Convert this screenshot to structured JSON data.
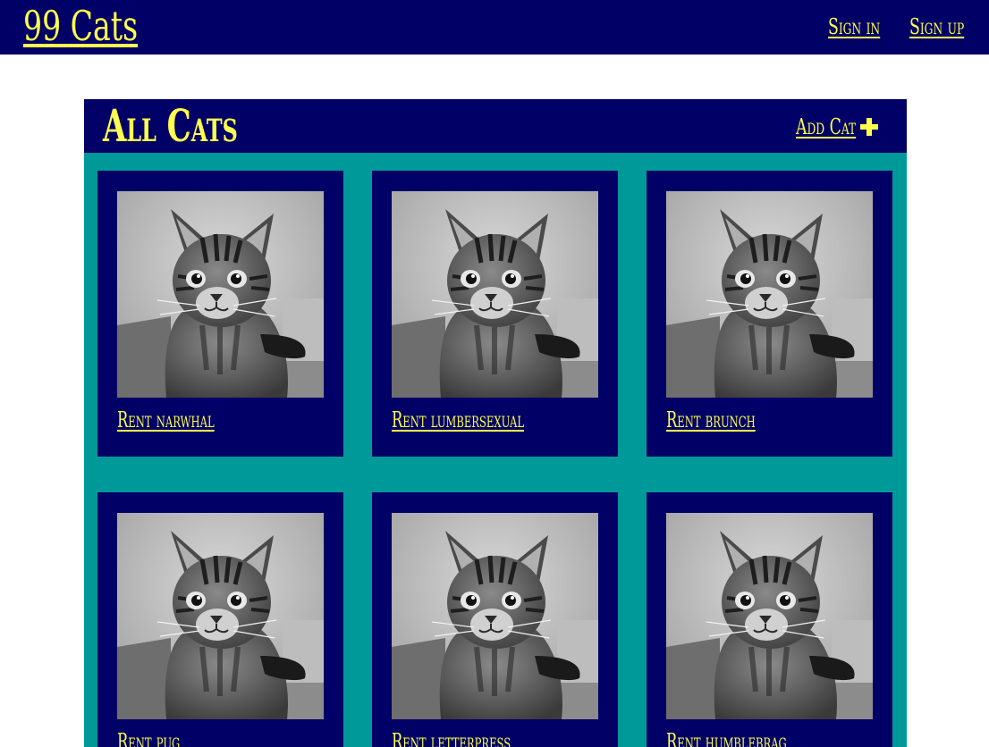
{
  "site": {
    "logo_text": "99 Cats",
    "nav": [
      {
        "label": "Sign in"
      },
      {
        "label": "Sign up"
      }
    ]
  },
  "colors": {
    "navy": "#000066",
    "teal": "#009999",
    "accent_yellow": "#ffff4d"
  },
  "panel": {
    "title": "All Cats",
    "add_label": "Add Cat",
    "add_icon": "plus-icon"
  },
  "cats": [
    {
      "link_text": "Rent narwhal",
      "image": "kitten-photo"
    },
    {
      "link_text": "Rent lumbersexual",
      "image": "kitten-photo"
    },
    {
      "link_text": "Rent brunch",
      "image": "kitten-photo"
    },
    {
      "link_text": "Rent pug",
      "image": "kitten-photo"
    },
    {
      "link_text": "Rent letterpress",
      "image": "kitten-photo"
    },
    {
      "link_text": "Rent humblebrag",
      "image": "kitten-photo"
    }
  ]
}
